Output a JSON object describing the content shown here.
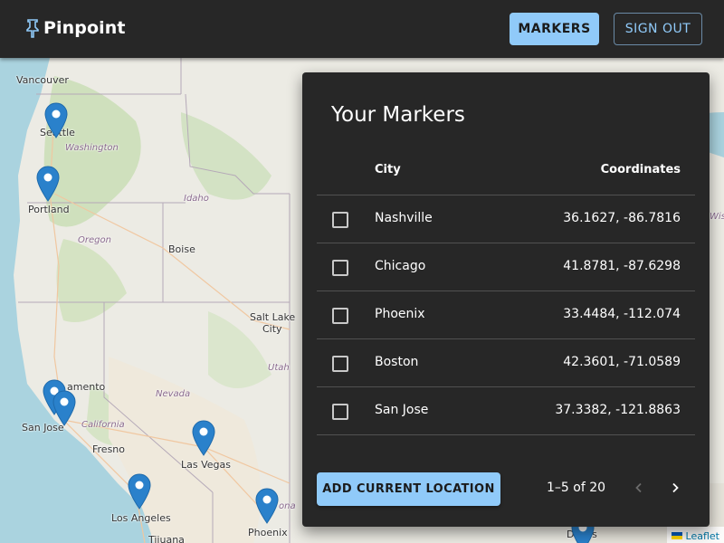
{
  "app": {
    "name": "Pinpoint"
  },
  "header": {
    "markers_label": "MARKERS",
    "signout_label": "SIGN OUT"
  },
  "map": {
    "labels": {
      "vancouver": "Vancouver",
      "seattle": "Seattle",
      "washington": "Washington",
      "portland": "Portland",
      "oregon": "Oregon",
      "idaho": "Idaho",
      "boise": "Boise",
      "salt_lake_city_1": "Salt Lake",
      "salt_lake_city_2": "City",
      "utah": "Utah",
      "nevada": "Nevada",
      "sacramento": "amento",
      "san_jose": "San Jose",
      "california": "California",
      "fresno": "Fresno",
      "las_vegas": "Las Vegas",
      "los_angeles": "Los Angeles",
      "phoenix": "Phoenix",
      "tijuana": "Tijuana",
      "arizona": "ona",
      "dallas": "Dallas",
      "wisconsin": "Wisc"
    },
    "attribution": "Leaflet"
  },
  "panel": {
    "title": "Your Markers",
    "columns": {
      "city": "City",
      "coordinates": "Coordinates"
    },
    "rows": [
      {
        "city": "Nashville",
        "coordinates": "36.1627, -86.7816",
        "checked": false
      },
      {
        "city": "Chicago",
        "coordinates": "41.8781, -87.6298",
        "checked": false
      },
      {
        "city": "Phoenix",
        "coordinates": "33.4484, -112.074",
        "checked": false
      },
      {
        "city": "Boston",
        "coordinates": "42.3601, -71.0589",
        "checked": false
      },
      {
        "city": "San Jose",
        "coordinates": "37.3382, -121.8863",
        "checked": false
      }
    ],
    "add_button": "ADD CURRENT LOCATION",
    "pagination": "1–5 of 20"
  },
  "colors": {
    "accent": "#90caf9",
    "panel_bg": "#272727",
    "marker_blue": "#2a81cb"
  }
}
